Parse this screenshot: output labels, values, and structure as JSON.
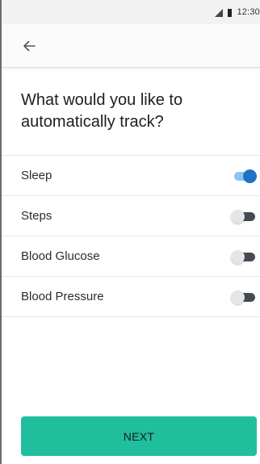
{
  "status_bar": {
    "time": "12:30",
    "icons": [
      "signal-icon",
      "battery-icon"
    ]
  },
  "app_bar": {
    "back_icon": "arrow-back-icon"
  },
  "title": "What would you like to automatically track?",
  "tracking_options": [
    {
      "label": "Sleep",
      "enabled": true
    },
    {
      "label": "Steps",
      "enabled": false
    },
    {
      "label": "Blood Glucose",
      "enabled": false
    },
    {
      "label": "Blood Pressure",
      "enabled": false
    }
  ],
  "next_button": {
    "label": "NEXT"
  },
  "colors": {
    "accent": "#1fbf9e",
    "toggle_on_thumb": "#1f72c4",
    "toggle_on_track": "#8fc3ef",
    "toggle_off_track": "#444a52"
  }
}
